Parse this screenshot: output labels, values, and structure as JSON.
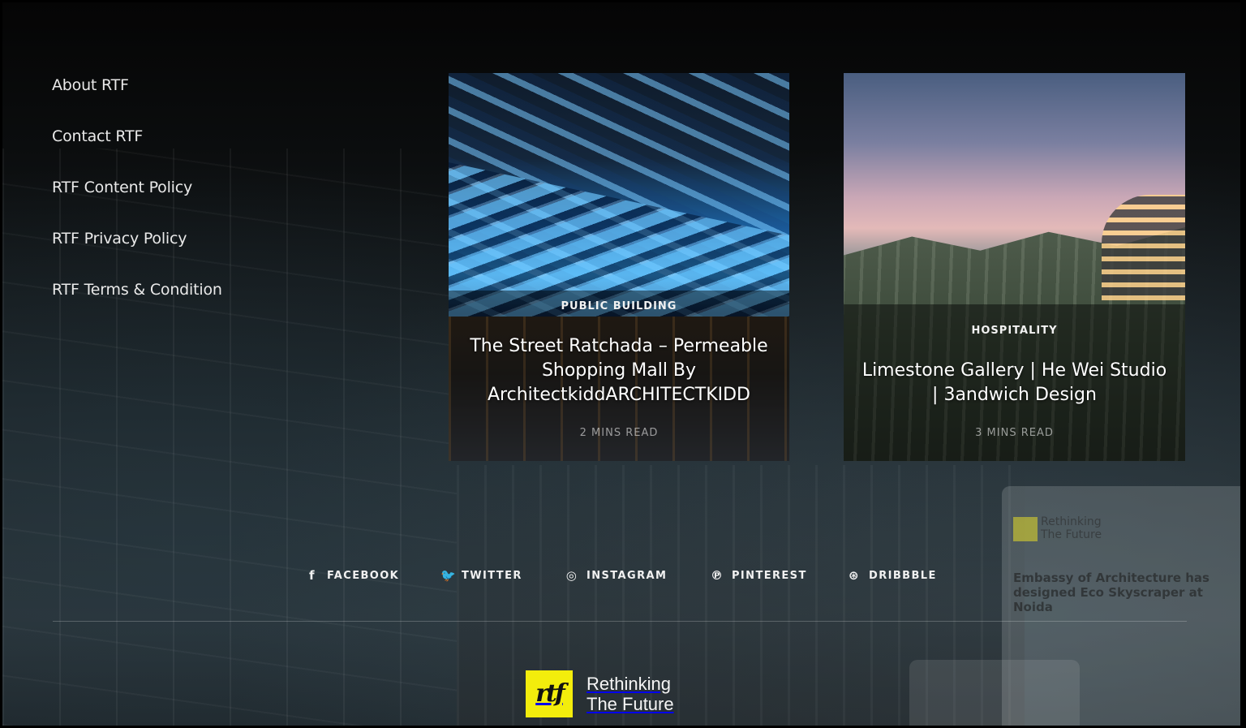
{
  "footer_nav": [
    {
      "label": "About RTF"
    },
    {
      "label": "Contact RTF"
    },
    {
      "label": "RTF Content Policy"
    },
    {
      "label": "RTF Privacy Policy"
    },
    {
      "label": "RTF Terms & Condition"
    }
  ],
  "cards": [
    {
      "category": "PUBLIC BUILDING",
      "title": "The Street Ratchada – Permeable Shopping Mall By ArchitectkiddARCHITECTKIDD",
      "read_time": "2 MINS READ"
    },
    {
      "category": "HOSPITALITY",
      "title": "Limestone Gallery | He Wei Studio | 3andwich Design",
      "read_time": "3 MINS READ"
    }
  ],
  "social": [
    {
      "label": "FACEBOOK",
      "icon": "f"
    },
    {
      "label": "TWITTER",
      "icon": "🐦"
    },
    {
      "label": "INSTAGRAM",
      "icon": "◎"
    },
    {
      "label": "PINTEREST",
      "icon": "℗"
    },
    {
      "label": "DRIBBBLE",
      "icon": "⊛"
    }
  ],
  "brand": {
    "mark": "rtf",
    "line1": "Rethinking",
    "line2": "The Future"
  },
  "background_mockup": {
    "brand_line1": "Rethinking",
    "brand_line2": "The Future",
    "headline": "Embassy of Architecture has designed Eco Skyscraper at Noida"
  },
  "colors": {
    "accent_yellow": "#f3ed0c",
    "text": "#ffffff",
    "background": "#0b0d0e"
  }
}
